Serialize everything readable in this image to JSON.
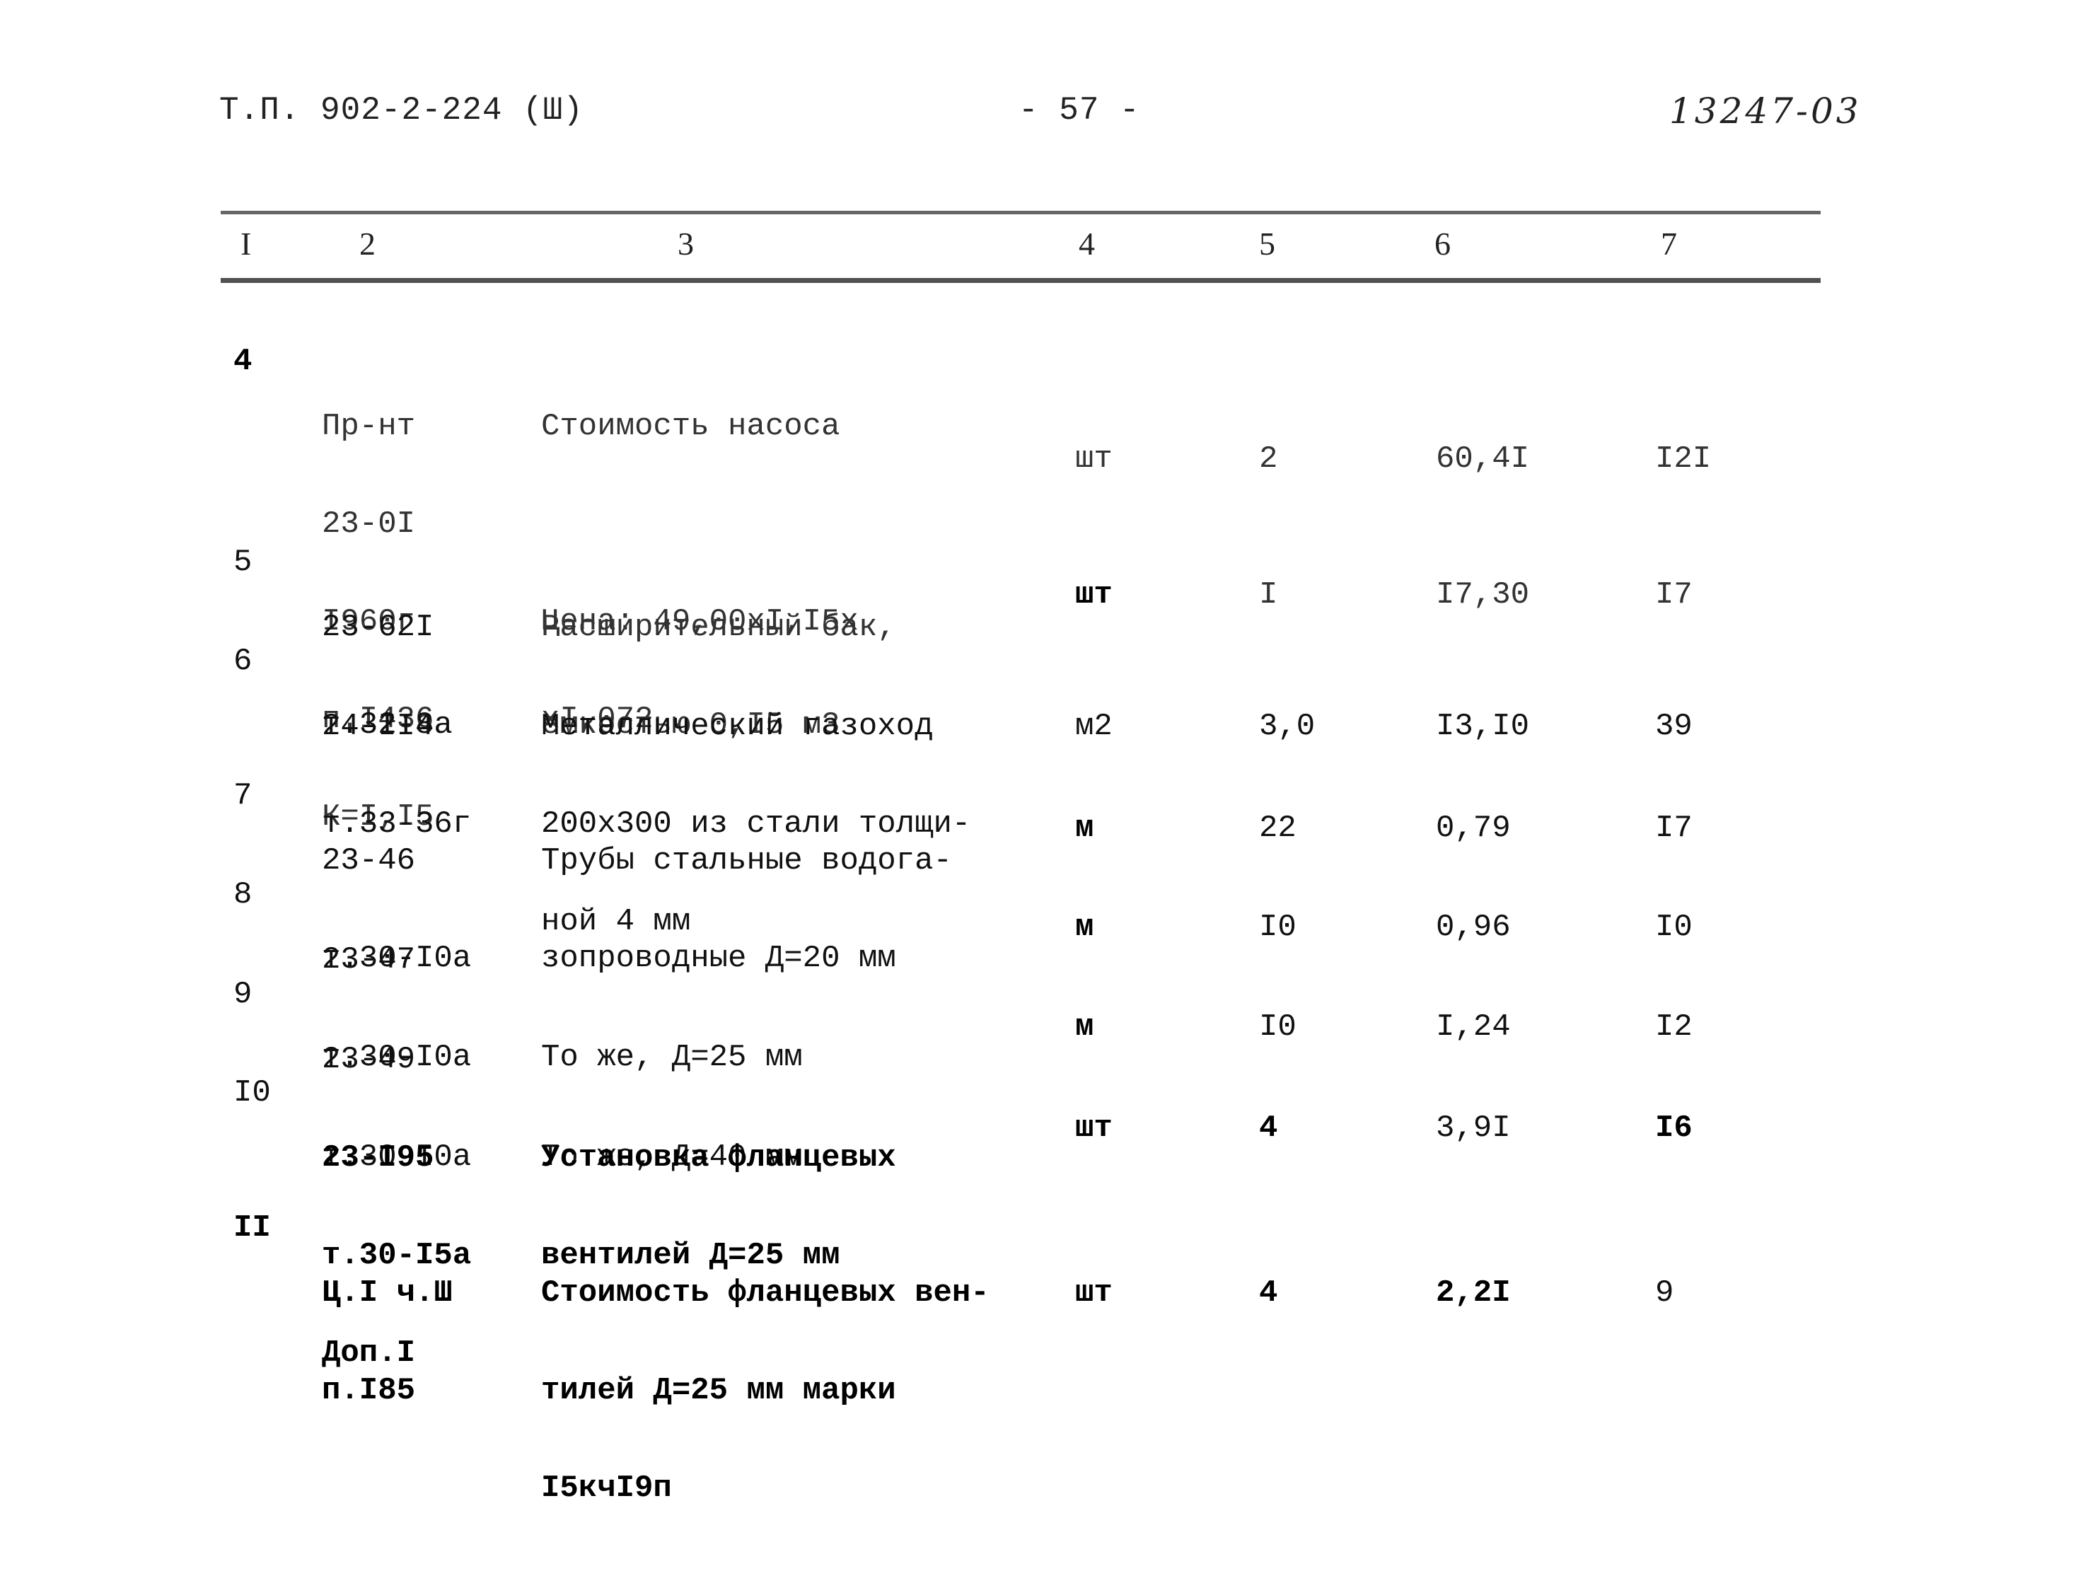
{
  "header": {
    "doc_code": "Т.П. 902-2-224 (Ш)",
    "page_number": "- 57 -",
    "archive_number": "13247-03"
  },
  "table": {
    "column_numbers": [
      "I",
      "2",
      "3",
      "4",
      "5",
      "6",
      "7"
    ],
    "rows": [
      {
        "no": "4",
        "ref": [
          "Пр-нт",
          "23-0I",
          "I960г",
          "п.I436",
          "К=I,I5"
        ],
        "desc": [
          "Стоимость насоса",
          "",
          "Цена: 49,00хI,I5х",
          "хI,072"
        ],
        "unit": "шт",
        "qty": "2",
        "price": "60,4I",
        "total": "I2I"
      },
      {
        "no": "5",
        "ref": [
          "23-62I",
          "т.32-8а"
        ],
        "desc": [
          "Расширительный бак,",
          "емкостью 0,I5 м3"
        ],
        "unit": "шт",
        "qty": "I",
        "price": "I7,30",
        "total": "I7"
      },
      {
        "no": "6",
        "ref": [
          "24-II4",
          "т.33-36г"
        ],
        "desc": [
          "Металлический газоход",
          "200х300 из стали толщи-",
          "ной 4 мм"
        ],
        "unit": "м2",
        "qty": "3,0",
        "price": "I3,I0",
        "total": "39"
      },
      {
        "no": "7",
        "ref": [
          "23-46",
          "т.30-I0а"
        ],
        "desc": [
          "Трубы стальные водога-",
          "зопроводные Д=20 мм"
        ],
        "unit": "м",
        "qty": "22",
        "price": "0,79",
        "total": "I7"
      },
      {
        "no": "8",
        "ref": [
          "23-47",
          "т.30-I0а"
        ],
        "desc": [
          "",
          "То же, Д=25 мм"
        ],
        "unit": "м",
        "qty": "I0",
        "price": "0,96",
        "total": "I0"
      },
      {
        "no": "9",
        "ref": [
          "23-49",
          "т.30-I0а"
        ],
        "desc": [
          "",
          "То же, Д=40 мм"
        ],
        "unit": "м",
        "qty": "I0",
        "price": "I,24",
        "total": "I2"
      },
      {
        "no": "I0",
        "ref": [
          "23-I95",
          "т.30-I5а",
          "Доп.I"
        ],
        "desc": [
          "Установка фланцевых",
          "вентилей Д=25 мм"
        ],
        "unit": "шт",
        "qty": "4",
        "price": "3,9I",
        "total": "I6"
      },
      {
        "no": "II",
        "ref": [
          "Ц.I ч.Ш",
          "п.I85"
        ],
        "desc": [
          "Стоимость фланцевых вен-",
          "тилей Д=25 мм марки",
          "I5кчI9п"
        ],
        "unit": "шт",
        "qty": "4",
        "price": "2,2I",
        "total": "9"
      }
    ]
  }
}
